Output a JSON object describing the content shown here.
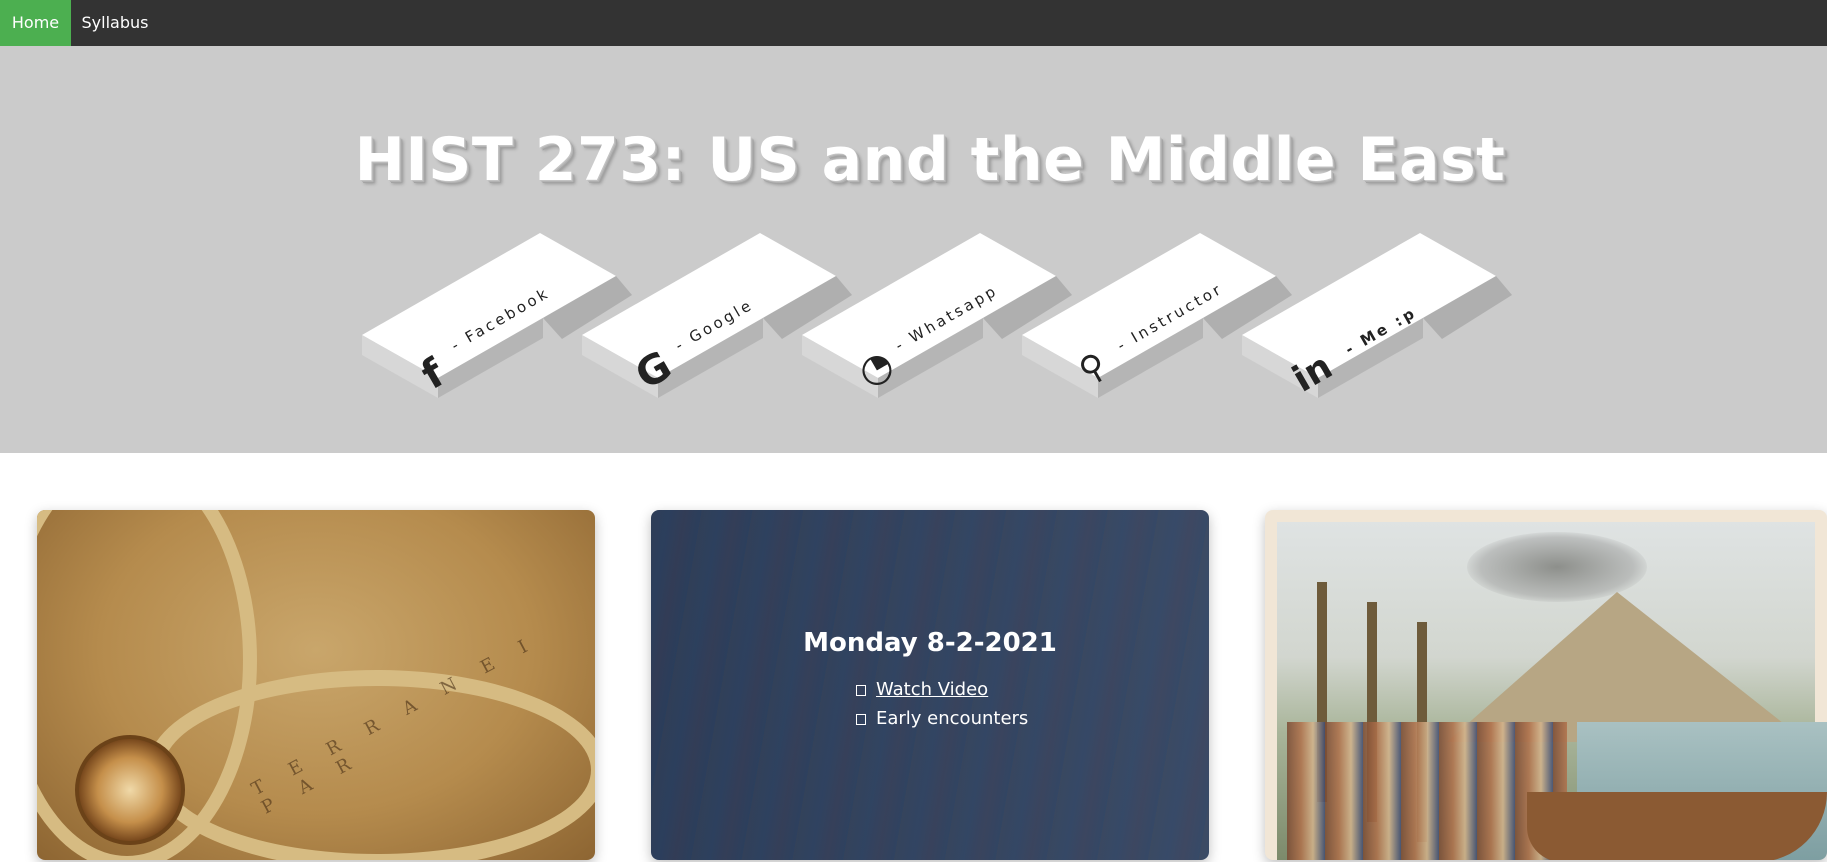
{
  "nav": {
    "home": "Home",
    "syllabus": "Syllabus"
  },
  "hero": {
    "title": "HIST 273: US and the Middle East",
    "social": [
      {
        "icon": "facebook-icon",
        "glyph": "f",
        "label": "- Facebook"
      },
      {
        "icon": "google-icon",
        "glyph": "G",
        "label": "- Google"
      },
      {
        "icon": "whatsapp-icon",
        "glyph": "◔",
        "label": "- Whatsapp"
      },
      {
        "icon": "share-icon",
        "glyph": "⚲",
        "label": "- Instructor"
      },
      {
        "icon": "linkedin-icon",
        "glyph": "in",
        "label": "- Me :p"
      }
    ]
  },
  "cards": {
    "map": {
      "text": "T E R R A N E I   P A R"
    },
    "middle": {
      "title": "Monday 8-2-2021",
      "items": [
        {
          "text": "Watch Video",
          "is_link": true
        },
        {
          "text": "Early encounters",
          "is_link": false
        }
      ]
    }
  },
  "colors": {
    "nav_bg": "#333333",
    "nav_active": "#4caf50",
    "hero_bg": "#cbcbcb",
    "card_overlay": "#364a63"
  }
}
